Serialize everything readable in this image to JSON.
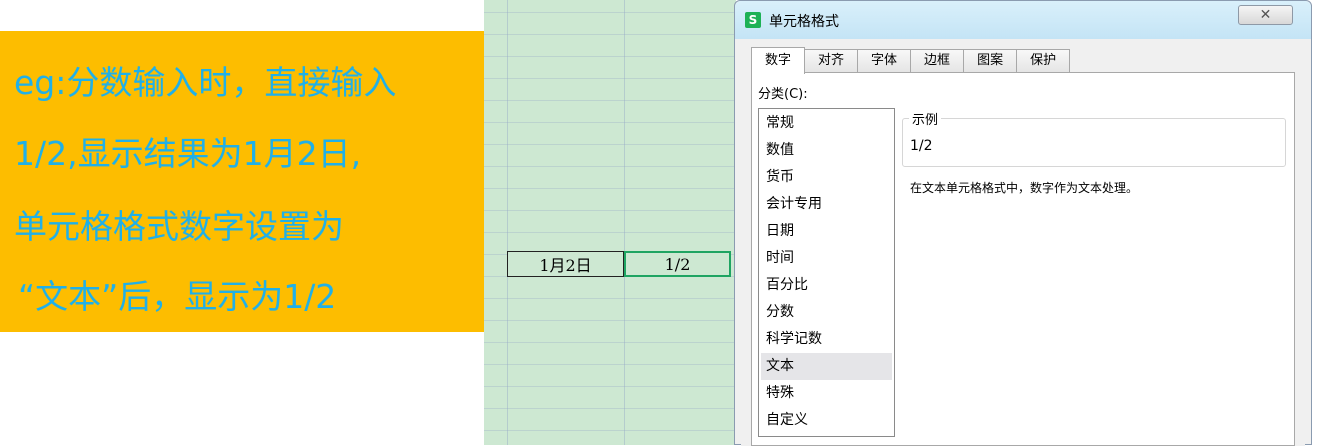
{
  "annotation": {
    "lines": [
      "eg:分数输入时，直接输入",
      "1/2,显示结果为1月2日,",
      "单元格格式数字设置为",
      "“文本”后，显示为1/2"
    ]
  },
  "sheet": {
    "cell_a": "1月2日",
    "cell_b": "1/2"
  },
  "dialog": {
    "title": "单元格格式",
    "app_icon": "S",
    "close_glyph": "✕",
    "tabs": [
      "数字",
      "对齐",
      "字体",
      "边框",
      "图案",
      "保护"
    ],
    "active_tab": "数字",
    "category_label": "分类(C):",
    "categories": [
      "常规",
      "数值",
      "货币",
      "会计专用",
      "日期",
      "时间",
      "百分比",
      "分数",
      "科学记数",
      "文本",
      "特殊",
      "自定义"
    ],
    "selected_category": "文本",
    "sample_legend": "示例",
    "sample_value": "1/2",
    "description": "在文本单元格格式中，数字作为文本处理。"
  },
  "colors": {
    "banner_bg": "#fdbd00",
    "banner_text": "#20b0e8",
    "sheet_bg": "#cde8d2",
    "active_cell_border": "#1fa462",
    "titlebar": "#c4e4f5"
  }
}
